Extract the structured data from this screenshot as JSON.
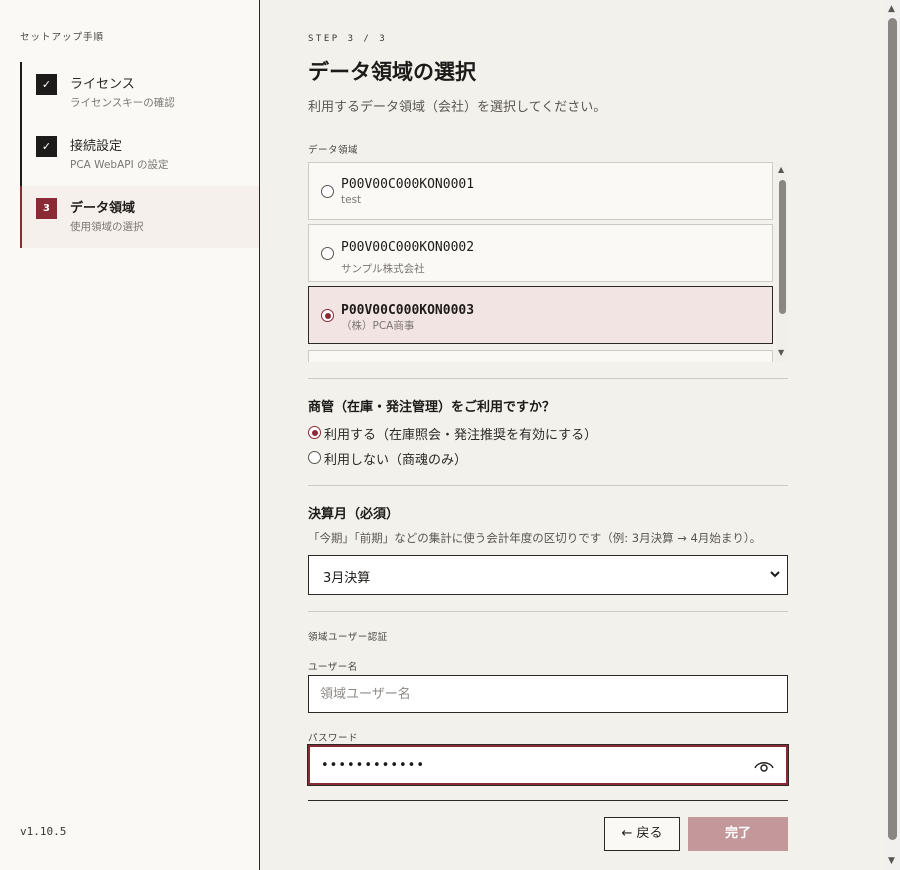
{
  "sidebar": {
    "title": "セットアップ手順",
    "steps": [
      {
        "badge": "✓",
        "title": "ライセンス",
        "sub": "ライセンスキーの確認"
      },
      {
        "badge": "✓",
        "title": "接続設定",
        "sub": "PCA WebAPI の設定"
      },
      {
        "badge": "3",
        "title": "データ領域",
        "sub": "使用領域の選択"
      }
    ],
    "version": "v1.10.5"
  },
  "main": {
    "kicker": "STEP 3 / 3",
    "title": "データ領域の選択",
    "description": "利用するデータ領域（会社）を選択してください。",
    "area_label": "データ領域",
    "areas": [
      {
        "code": "P00V00C000KON0001",
        "name": "test",
        "selected": false
      },
      {
        "code": "P00V00C000KON0002",
        "name": "サンプル株式会社",
        "selected": false
      },
      {
        "code": "P00V00C000KON0003",
        "name": "（株）PCA商事",
        "selected": true
      }
    ],
    "inventory": {
      "title": "商管（在庫・発注管理）をご利用ですか？",
      "options": [
        {
          "label": "利用する（在庫照会・発注推奨を有効にする）",
          "selected": true
        },
        {
          "label": "利用しない（商魂のみ）",
          "selected": false
        }
      ]
    },
    "fiscal": {
      "title": "決算月（必須）",
      "hint": "「今期」「前期」などの集計に使う会計年度の区切りです（例: 3月決算 → 4月始まり）。",
      "value": "3月決算"
    },
    "auth": {
      "section_label": "領域ユーザー認証",
      "username_label": "ユーザー名",
      "username_placeholder": "領域ユーザー名",
      "password_label": "パスワード",
      "password_value": "••••••••••••"
    },
    "buttons": {
      "back": "← 戻る",
      "finish": "完了"
    }
  },
  "colors": {
    "accent": "#8a2a35",
    "selected_bg": "#f3e4e4",
    "disabled_primary": "#c4979a"
  }
}
